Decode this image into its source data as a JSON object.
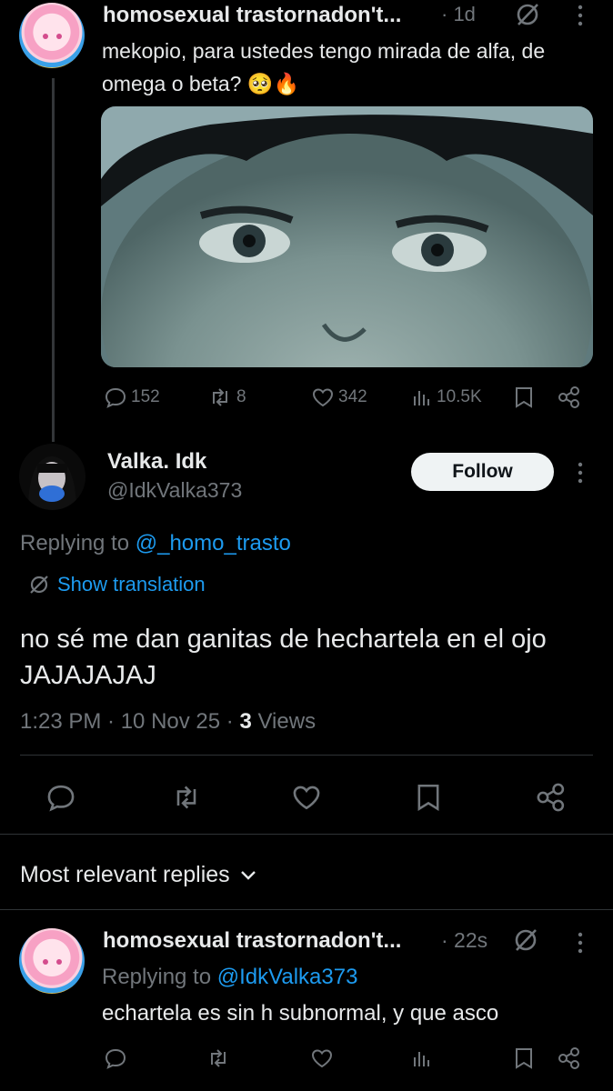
{
  "parent_tweet": {
    "display_name": "homosexual trastornadon't...",
    "time": "· 1d",
    "text": "mekopio, para ustedes tengo mirada de alfa, de omega o beta? 🥺🔥",
    "stats": {
      "replies": "152",
      "reposts": "8",
      "likes": "342",
      "views": "10.5K"
    }
  },
  "main_tweet": {
    "display_name": "Valka. Idk",
    "handle": "@IdkValka373",
    "follow_label": "Follow",
    "replying_prefix": "Replying to ",
    "replying_to": "@_homo_trasto",
    "show_translation": "Show translation",
    "text": "no sé me dan ganitas de hechartela en el ojo JAJAJAJAJ",
    "time": "1:23 PM · 10 Nov 25 · ",
    "views_count": "3",
    "views_label": " Views"
  },
  "replies_header": {
    "label": "Most relevant replies"
  },
  "reply": {
    "display_name": "homosexual trastornadon't...",
    "time": "· 22s",
    "replying_prefix": "Replying to ",
    "replying_to": "@IdkValka373",
    "text": "echartela es sin h subnormal, y que asco"
  },
  "icons": [
    "reply-icon",
    "repost-icon",
    "like-icon",
    "views-icon",
    "bookmark-icon",
    "share-icon",
    "grok-icon",
    "more-icon",
    "chevron-down-icon",
    "translate-icon"
  ],
  "colors": {
    "background": "#000000",
    "text": "#e7e9ea",
    "muted": "#71767b",
    "accent": "#1d9bf0"
  }
}
